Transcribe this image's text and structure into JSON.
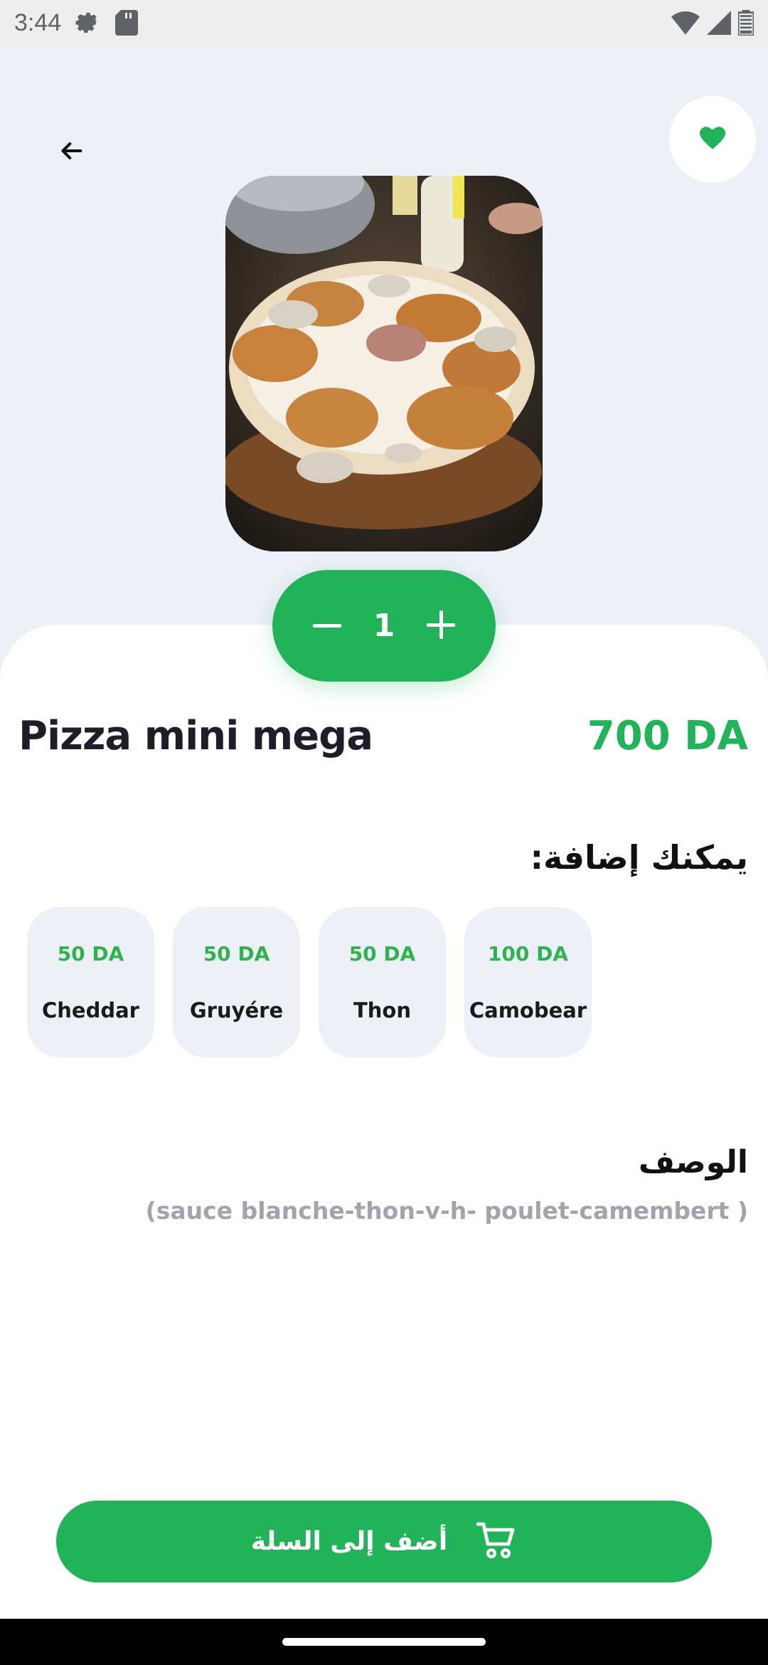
{
  "status_bar": {
    "time": "3:44",
    "icons": [
      "settings-gear-icon",
      "sd-card-icon",
      "wifi-icon",
      "cell-signal-icon",
      "battery-icon"
    ]
  },
  "header": {
    "back_icon": "arrow-left-icon",
    "favorite_icon": "heart-icon"
  },
  "product": {
    "image_alt": "pizza",
    "name": "Pizza mini mega",
    "price": "700 DA",
    "quantity": "1"
  },
  "addons": {
    "title": "يمكنك إضافة:",
    "items": [
      {
        "price": "50 DA",
        "name": "Cheddar"
      },
      {
        "price": "50 DA",
        "name": "Gruyére"
      },
      {
        "price": "50 DA",
        "name": "Thon"
      },
      {
        "price": "100 DA",
        "name": "Camobear"
      }
    ]
  },
  "description": {
    "title": "الوصف",
    "text": "(sauce blanche-thon-v-h- poulet-camembert )"
  },
  "cta": {
    "label": "أضف إلى السلة",
    "icon": "cart-icon"
  },
  "colors": {
    "accent": "#22b35a",
    "background": "#eef0f8",
    "text_dark": "#1e1e2a",
    "text_muted": "#a3a3ad"
  }
}
